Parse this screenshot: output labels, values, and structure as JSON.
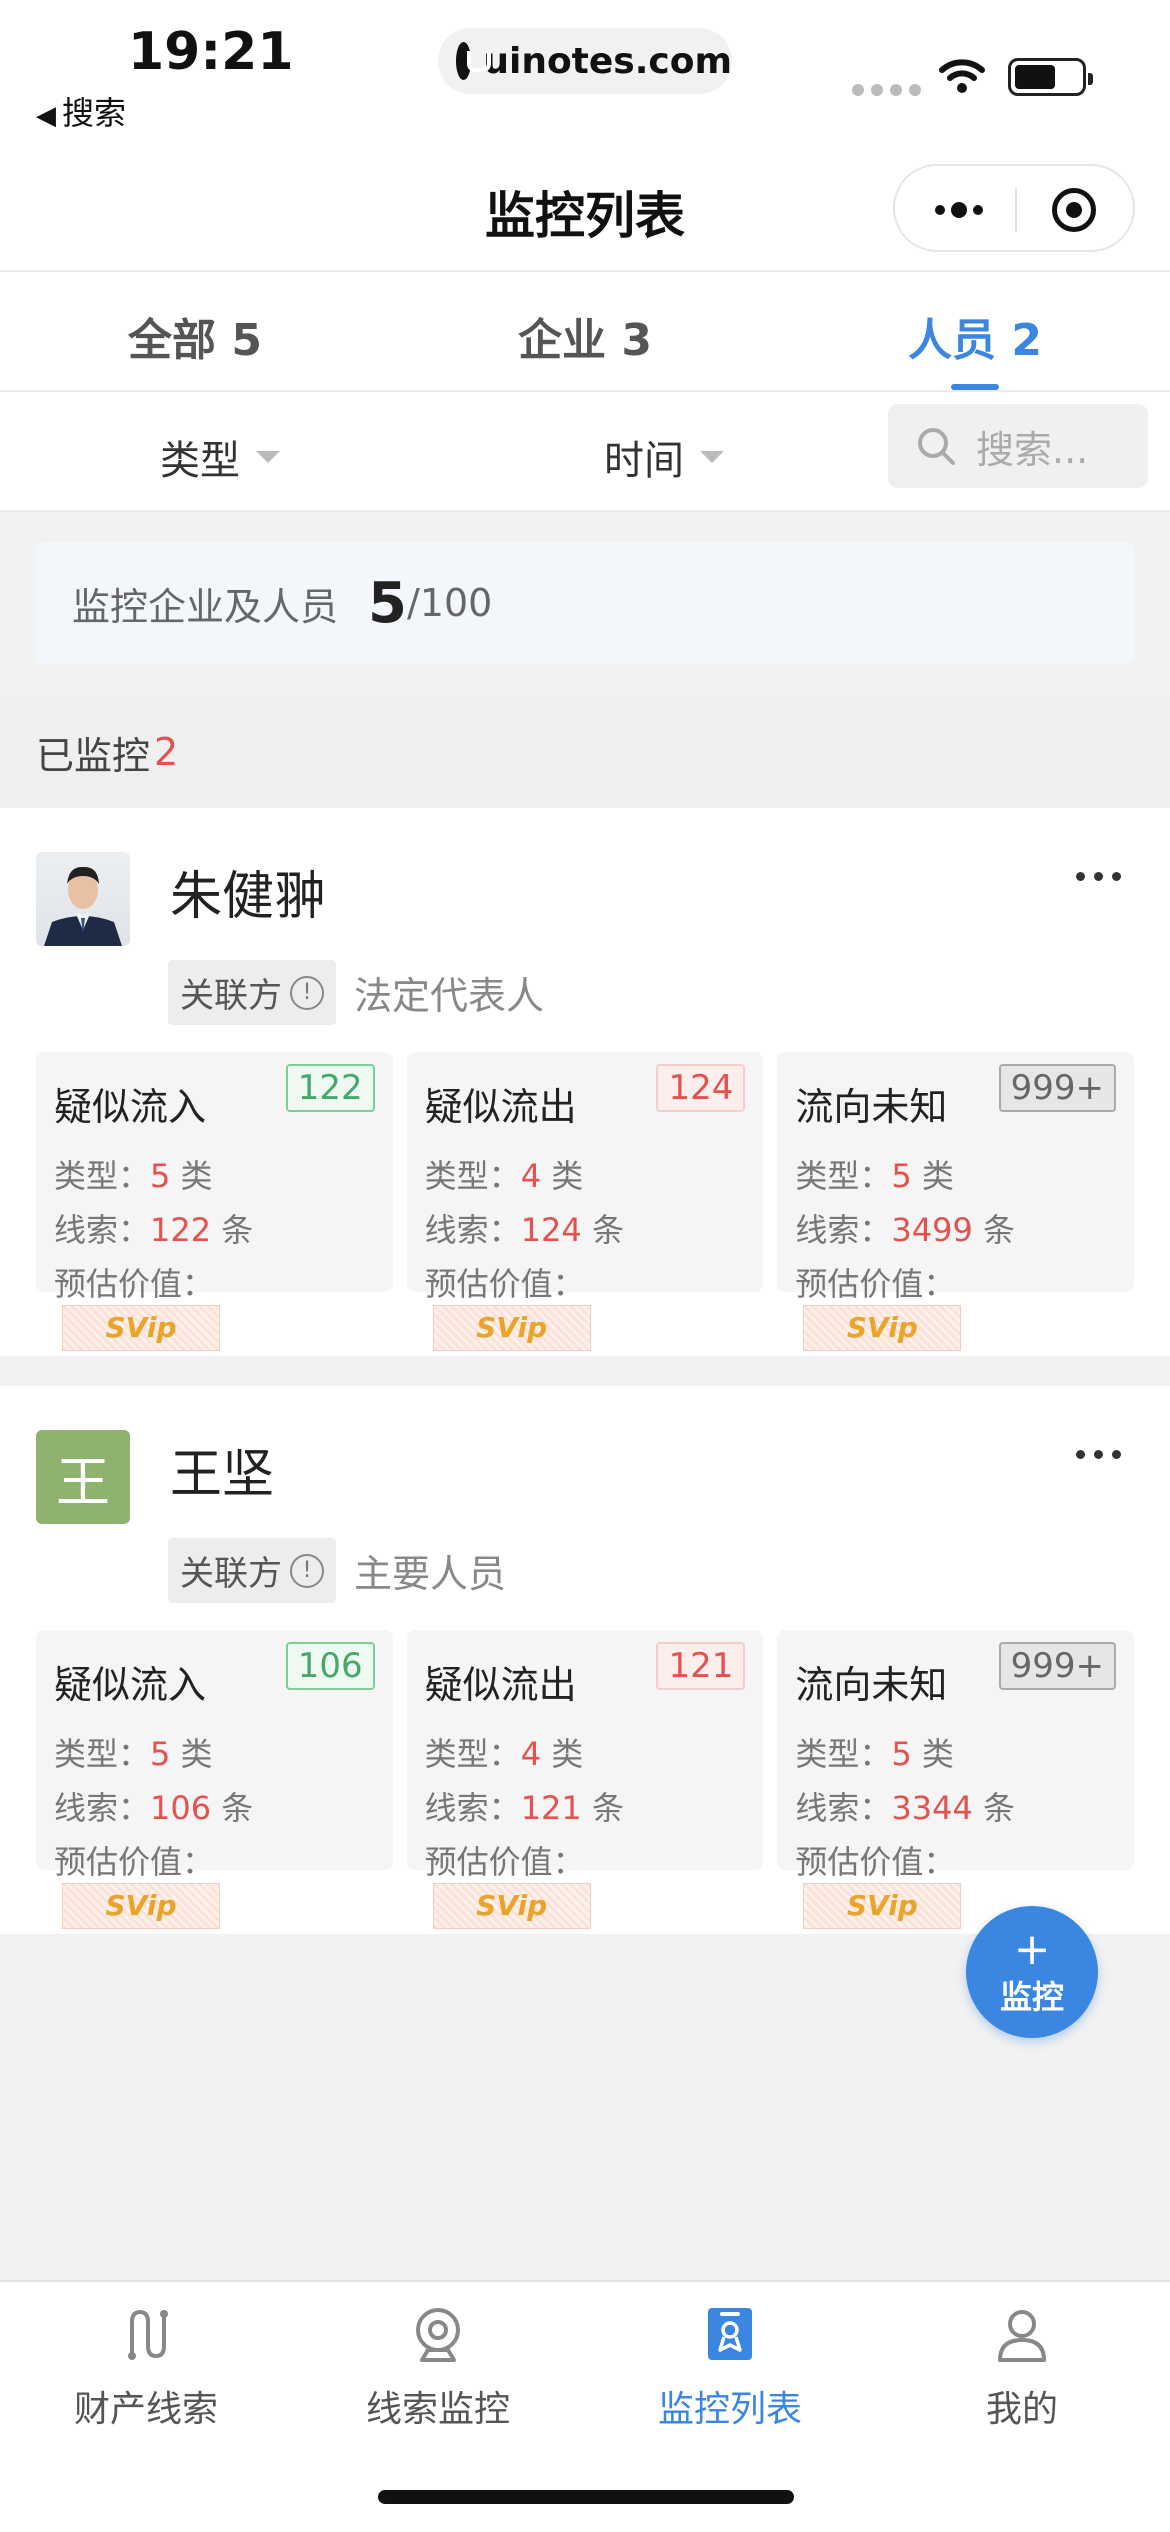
{
  "status_bar": {
    "time": "19:21",
    "back_label": "搜索",
    "url": "uinotes.com"
  },
  "navbar": {
    "title": "监控列表"
  },
  "tabs": [
    {
      "label": "全部 5",
      "active": false
    },
    {
      "label": "企业 3",
      "active": false
    },
    {
      "label": "人员 2",
      "active": true
    }
  ],
  "filters": {
    "type_label": "类型",
    "time_label": "时间",
    "search_placeholder": "搜索..."
  },
  "quota": {
    "label": "监控企业及人员",
    "used": "5",
    "total": "/100"
  },
  "section": {
    "label": "已监控",
    "count": "2"
  },
  "persons": [
    {
      "name": "朱健翀",
      "avatar": "photo",
      "relation_tag": "关联方",
      "relation_role": "法定代表人",
      "stats": [
        {
          "title": "疑似流入",
          "badge": "122",
          "badge_color": "green",
          "type_label": "类型：",
          "type_value": "5",
          "type_unit": " 类",
          "clue_label": "线索：",
          "clue_value": "122",
          "clue_unit": " 条",
          "value_label": "预估价值：",
          "vip_text": "SVip"
        },
        {
          "title": "疑似流出",
          "badge": "124",
          "badge_color": "red",
          "type_label": "类型：",
          "type_value": "4",
          "type_unit": " 类",
          "clue_label": "线索：",
          "clue_value": "124",
          "clue_unit": " 条",
          "value_label": "预估价值：",
          "vip_text": "SVip"
        },
        {
          "title": "流向未知",
          "badge": "999+",
          "badge_color": "gray",
          "type_label": "类型：",
          "type_value": "5",
          "type_unit": " 类",
          "clue_label": "线索：",
          "clue_value": "3499",
          "clue_unit": " 条",
          "value_label": "预估价值：",
          "vip_text": "SVip"
        }
      ]
    },
    {
      "name": "王坚",
      "avatar": "王",
      "relation_tag": "关联方",
      "relation_role": "主要人员",
      "stats": [
        {
          "title": "疑似流入",
          "badge": "106",
          "badge_color": "green",
          "type_label": "类型：",
          "type_value": "5",
          "type_unit": " 类",
          "clue_label": "线索：",
          "clue_value": "106",
          "clue_unit": " 条",
          "value_label": "预估价值：",
          "vip_text": "SVip"
        },
        {
          "title": "疑似流出",
          "badge": "121",
          "badge_color": "red",
          "type_label": "类型：",
          "type_value": "4",
          "type_unit": " 类",
          "clue_label": "线索：",
          "clue_value": "121",
          "clue_unit": " 条",
          "value_label": "预估价值：",
          "vip_text": "SVip"
        },
        {
          "title": "流向未知",
          "badge": "999+",
          "badge_color": "gray",
          "type_label": "类型：",
          "type_value": "5",
          "type_unit": " 类",
          "clue_label": "线索：",
          "clue_value": "3344",
          "clue_unit": " 条",
          "value_label": "预估价值：",
          "vip_text": "SVip"
        }
      ]
    }
  ],
  "fab": {
    "icon": "plus-icon",
    "label": "监控"
  },
  "tabbar": [
    {
      "label": "财产线索",
      "icon": "route-icon",
      "active": false
    },
    {
      "label": "线索监控",
      "icon": "camera-icon",
      "active": false
    },
    {
      "label": "监控列表",
      "icon": "badge-list-icon",
      "active": true
    },
    {
      "label": "我的",
      "icon": "user-icon",
      "active": false
    }
  ],
  "colors": {
    "accent": "#3a86e0",
    "alert": "#e3524f",
    "green": "#46a769"
  }
}
